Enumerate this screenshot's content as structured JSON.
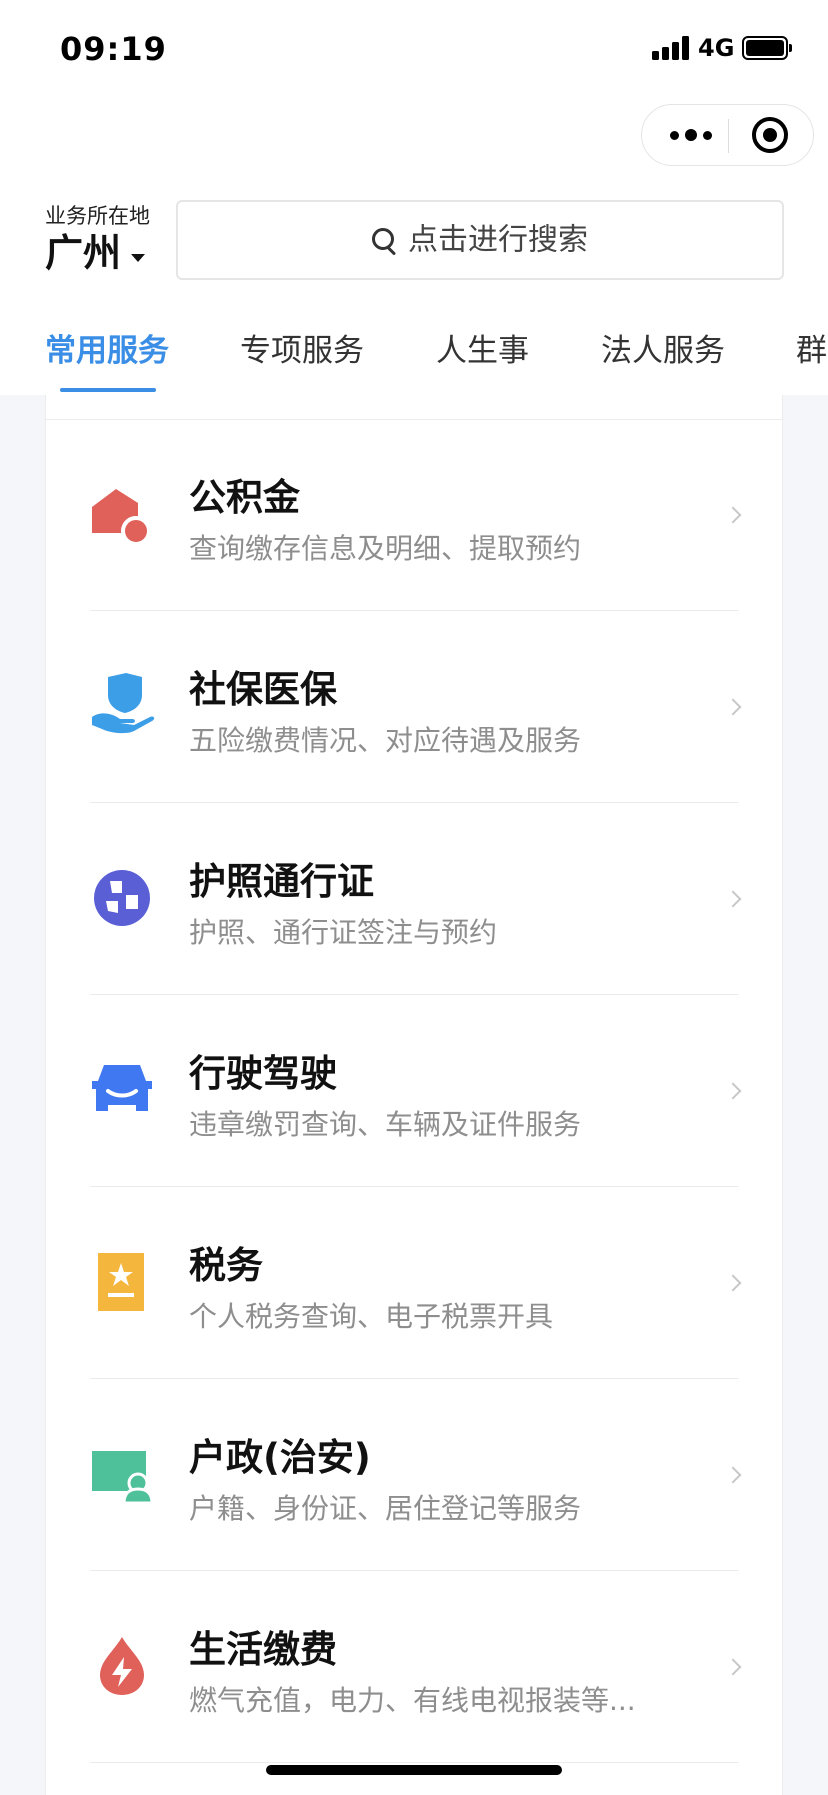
{
  "status_bar": {
    "time": "09:19",
    "network": "4G"
  },
  "capsule": {
    "more_icon": "ellipsis-icon",
    "close_icon": "target-circle-icon"
  },
  "location": {
    "label": "业务所在地",
    "city": "广州"
  },
  "search": {
    "placeholder": "点击进行搜索",
    "icon": "search-icon"
  },
  "tabs": [
    {
      "label": "常用服务",
      "active": true
    },
    {
      "label": "专项服务",
      "active": false
    },
    {
      "label": "人生事",
      "active": false
    },
    {
      "label": "法人服务",
      "active": false
    },
    {
      "label": "群",
      "active": false
    }
  ],
  "services": [
    {
      "title": "公积金",
      "desc": "查询缴存信息及明细、提取预约",
      "icon": "house-coin-icon",
      "color": "#e0605a"
    },
    {
      "title": "社保医保",
      "desc": "五险缴费情况、对应待遇及服务",
      "icon": "shield-hand-icon",
      "color": "#3d9ee8"
    },
    {
      "title": "护照通行证",
      "desc": "护照、通行证签注与预约",
      "icon": "globe-icon",
      "color": "#5a5fd6"
    },
    {
      "title": "行驶驾驶",
      "desc": "违章缴罚查询、车辆及证件服务",
      "icon": "car-icon",
      "color": "#3f78f0"
    },
    {
      "title": "税务",
      "desc": "个人税务查询、电子税票开具",
      "icon": "tax-star-icon",
      "color": "#f4b63c"
    },
    {
      "title": "户政(治安)",
      "desc": "户籍、身份证、居住登记等服务",
      "icon": "id-card-person-icon",
      "color": "#4fc19a"
    },
    {
      "title": "生活缴费",
      "desc": "燃气充值，电力、有线电视报装等...",
      "icon": "drop-bolt-icon",
      "color": "#e0605a"
    }
  ]
}
